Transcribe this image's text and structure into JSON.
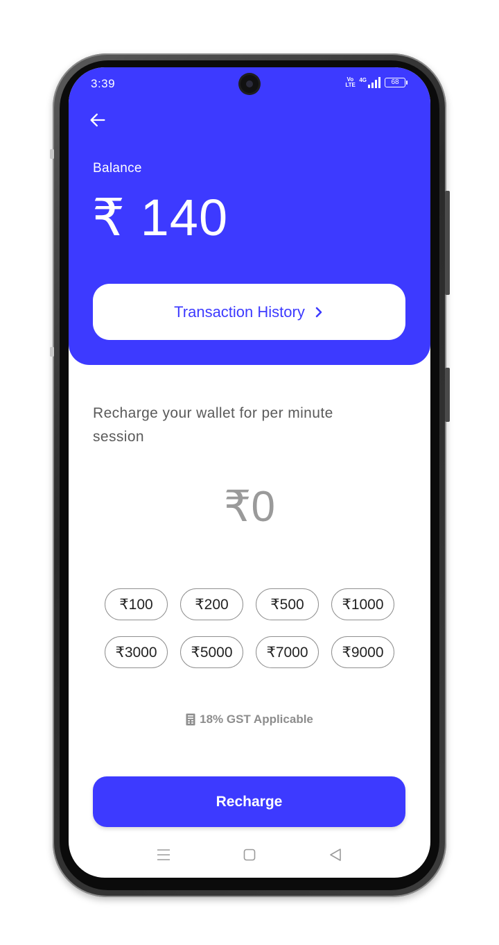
{
  "status_bar": {
    "time": "3:39",
    "volte": "Vo LTE",
    "network": "4G",
    "battery": "68"
  },
  "header": {
    "back_icon": "arrow-left-icon",
    "balance_label": "Balance",
    "balance_amount": "₹ 140",
    "transaction_history_label": "Transaction History",
    "transaction_history_icon": "chevron-right-icon"
  },
  "main": {
    "description": "Recharge your wallet for per minute session",
    "amount_display": "₹0",
    "amount_options": [
      "₹100",
      "₹200",
      "₹500",
      "₹1000",
      "₹3000",
      "₹5000",
      "₹7000",
      "₹9000"
    ],
    "gst_icon": "receipt-icon",
    "gst_note": "18% GST Applicable",
    "recharge_label": "Recharge"
  },
  "nav_bar": {
    "items": [
      "menu-icon",
      "home-square-icon",
      "back-triangle-icon"
    ]
  },
  "colors": {
    "primary": "#3d3aff",
    "text_muted": "#9a9a9a",
    "chip_border": "#8f8f8f"
  }
}
